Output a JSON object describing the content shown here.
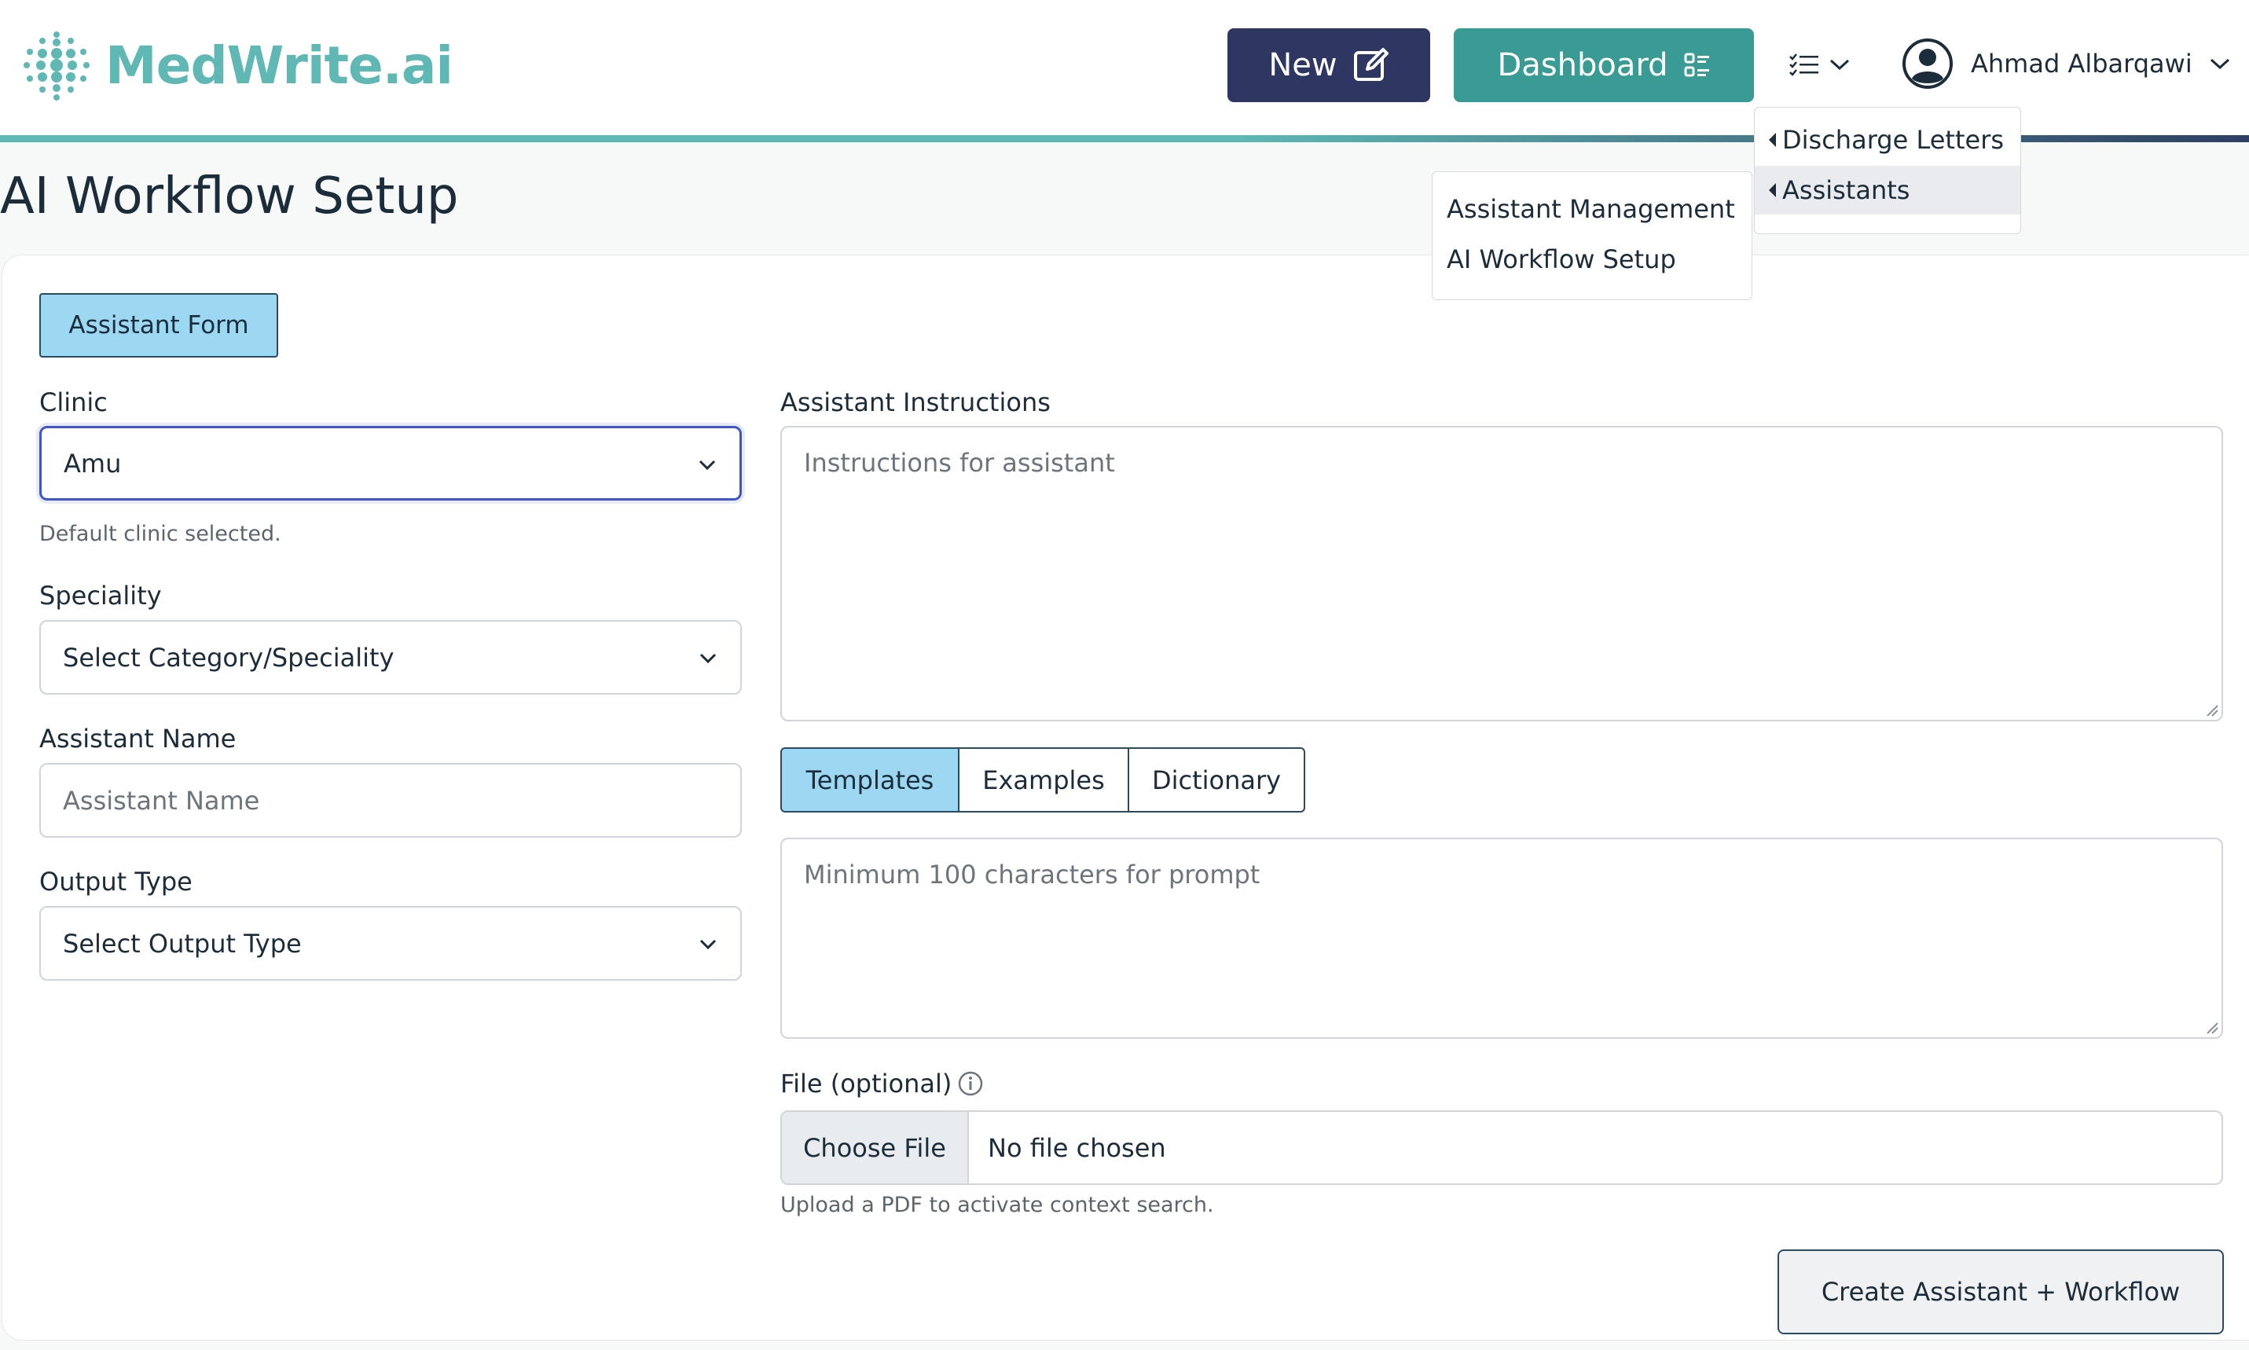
{
  "app": {
    "name": "MedWrite.ai"
  },
  "header": {
    "new_label": "New",
    "dashboard_label": "Dashboard",
    "user_name": "Ahmad Albarqawi",
    "brand_colors": {
      "teal": "#5fb8b4",
      "navy": "#2e3761",
      "dashboard": "#3a9a94"
    }
  },
  "menus": {
    "primary": [
      {
        "label": "Discharge Letters"
      },
      {
        "label": "Assistants"
      }
    ],
    "submenu": [
      {
        "label": "Assistant Management"
      },
      {
        "label": "AI Workflow Setup"
      }
    ]
  },
  "page": {
    "title": "AI Workflow Setup"
  },
  "form": {
    "tab_label": "Assistant Form",
    "clinic": {
      "label": "Clinic",
      "value": "Amu",
      "help": "Default clinic selected."
    },
    "speciality": {
      "label": "Speciality",
      "value": "Select Category/Speciality"
    },
    "assistant_name": {
      "label": "Assistant Name",
      "placeholder": "Assistant Name"
    },
    "output_type": {
      "label": "Output Type",
      "value": "Select Output Type"
    },
    "instructions": {
      "label": "Assistant Instructions",
      "placeholder": "Instructions for assistant"
    },
    "prompt_tabs": [
      {
        "label": "Templates"
      },
      {
        "label": "Examples"
      },
      {
        "label": "Dictionary"
      }
    ],
    "prompt": {
      "placeholder": "Minimum 100 characters for prompt"
    },
    "file": {
      "label": "File (optional)",
      "button": "Choose File",
      "status": "No file chosen",
      "help": "Upload a PDF to activate context search."
    },
    "submit_label": "Create Assistant + Workflow"
  }
}
